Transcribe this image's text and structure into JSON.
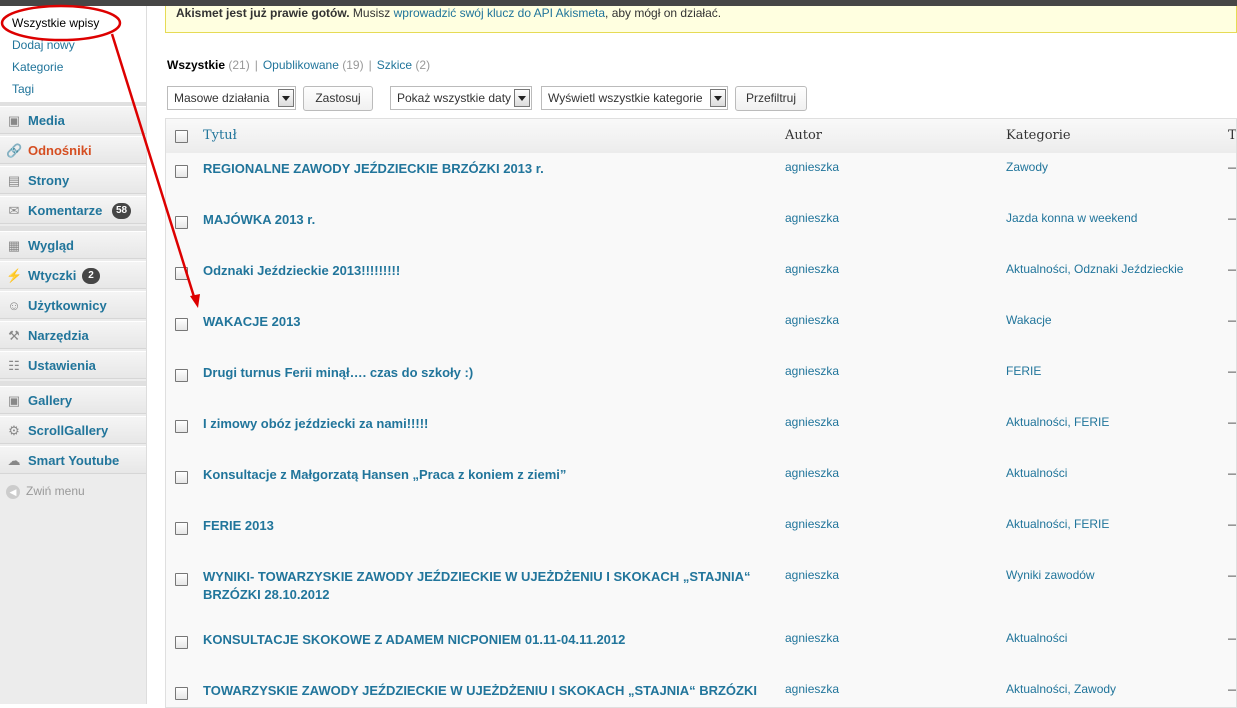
{
  "sidebar": {
    "submenu": [
      "Wszystkie wpisy",
      "Dodaj nowy",
      "Kategorie",
      "Tagi"
    ],
    "menu": [
      {
        "label": "Media",
        "icon": "media-icon",
        "glyph": "▣"
      },
      {
        "label": "Odnośniki",
        "icon": "link-icon",
        "glyph": "🔗"
      },
      {
        "label": "Strony",
        "icon": "pages-icon",
        "glyph": "▤"
      },
      {
        "label": "Komentarze",
        "icon": "comments-icon",
        "glyph": "✉",
        "badge": "58"
      },
      {
        "label": "Wygląd",
        "icon": "appearance-icon",
        "glyph": "▦"
      },
      {
        "label": "Wtyczki",
        "icon": "plugins-icon",
        "glyph": "⚡",
        "badge": "2"
      },
      {
        "label": "Użytkownicy",
        "icon": "users-icon",
        "glyph": "☺"
      },
      {
        "label": "Narzędzia",
        "icon": "tools-icon",
        "glyph": "⚒"
      },
      {
        "label": "Ustawienia",
        "icon": "settings-icon",
        "glyph": "☷"
      },
      {
        "label": "Gallery",
        "icon": "gallery-icon",
        "glyph": "▣"
      },
      {
        "label": "ScrollGallery",
        "icon": "gear-icon",
        "glyph": "⚙"
      },
      {
        "label": "Smart Youtube",
        "icon": "youtube-icon",
        "glyph": "☁"
      }
    ],
    "collapse": "Zwiń menu"
  },
  "notice": {
    "bold": "Akismet jest już prawie gotów.",
    "text1": " Musisz ",
    "link": "wprowadzić swój klucz do API Akismeta",
    "text2": ", aby mógł on działać."
  },
  "views": {
    "all": "Wszystkie",
    "all_count": "(21)",
    "published": "Opublikowane",
    "published_count": "(19)",
    "drafts": "Szkice",
    "drafts_count": "(2)",
    "sep": "|"
  },
  "filters": {
    "bulk": "Masowe działania",
    "apply": "Zastosuj",
    "dates": "Pokaż wszystkie daty",
    "cats": "Wyświetl wszystkie kategorie",
    "filter": "Przefiltruj"
  },
  "table": {
    "headers": {
      "title": "Tytuł",
      "author": "Autor",
      "categories": "Kategorie",
      "tags": "T"
    },
    "rows": [
      {
        "title": "REGIONALNE ZAWODY JEŹDZIECKIE BRZÓZKI 2013 r.",
        "author": "agnieszka",
        "categories": "Zawody",
        "tags": "—"
      },
      {
        "title": "MAJÓWKA 2013 r.",
        "author": "agnieszka",
        "categories": "Jazda konna w weekend",
        "tags": "—"
      },
      {
        "title": "Odznaki Jeździeckie 2013!!!!!!!!!",
        "author": "agnieszka",
        "categories": "Aktualności, Odznaki Jeździeckie",
        "tags": "—"
      },
      {
        "title": "WAKACJE 2013",
        "author": "agnieszka",
        "categories": "Wakacje",
        "tags": "—"
      },
      {
        "title": "Drugi turnus Ferii minął…. czas do szkoły :)",
        "author": "agnieszka",
        "categories": "FERIE",
        "tags": "—"
      },
      {
        "title": "I zimowy obóz jeździecki za nami!!!!!",
        "author": "agnieszka",
        "categories": "Aktualności, FERIE",
        "tags": "—"
      },
      {
        "title": "Konsultacje z Małgorzatą Hansen „Praca z koniem z ziemi”",
        "author": "agnieszka",
        "categories": "Aktualności",
        "tags": "—"
      },
      {
        "title": "FERIE 2013",
        "author": "agnieszka",
        "categories": "Aktualności, FERIE",
        "tags": "—"
      },
      {
        "title": "WYNIKI- TOWARZYSKIE ZAWODY JEŹDZIECKIE W UJEŻDŻENIU I SKOKACH „STAJNIA“ BRZÓZKI 28.10.2012",
        "author": "agnieszka",
        "categories": "Wyniki zawodów",
        "tags": "—"
      },
      {
        "title": "KONSULTACJE SKOKOWE Z ADAMEM NICPONIEM 01.11-04.11.2012",
        "author": "agnieszka",
        "categories": "Aktualności",
        "tags": "—"
      },
      {
        "title": "TOWARZYSKIE ZAWODY JEŹDZIECKIE W UJEŻDŻENIU I SKOKACH „STAJNIA“ BRZÓZKI",
        "author": "agnieszka",
        "categories": "Aktualności, Zawody",
        "tags": "—"
      }
    ]
  },
  "colors": {
    "link": "#21759b",
    "active": "#d54e21",
    "annotation": "#dd0000"
  }
}
